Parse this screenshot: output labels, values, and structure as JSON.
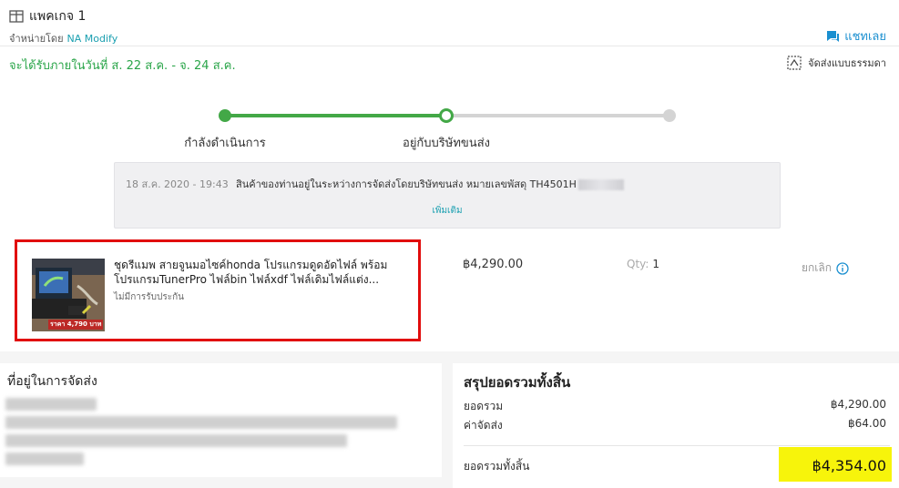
{
  "package": {
    "title": "แพคเกจ 1",
    "seller_label": "จำหน่ายโดย",
    "seller_name": "NA Modify",
    "chat_label": "แชทเลย"
  },
  "delivery": {
    "eta": "จะได้รับภายในวันที่ ส. 22 ส.ค. - จ. 24 ส.ค.",
    "method": "จัดส่งแบบธรรมดา"
  },
  "tracker": {
    "steps": [
      "กำลังดำเนินการ",
      "อยู่กับบริษัทขนส่ง"
    ],
    "step_count": 3,
    "current_step": 2,
    "colors": {
      "done": "#43a847",
      "pending": "#d4d4d4"
    }
  },
  "log": {
    "date": "18 ส.ค. 2020 - 19:43",
    "text": "สินค้าของท่านอยู่ในระหว่างการจัดส่งโดยบริษัทขนส่ง หมายเลขพัสดุ TH4501H",
    "more": "เพิ่มเติม"
  },
  "item": {
    "name": "ชุดรีแมพ สายจูนมอไซค์honda โปรแกรมดูดอัดไฟล์ พร้อมโปรแกรมTunerPro ไฟล์bin ไฟล์xdf ไฟล์เดิมไฟล์แต่ง...",
    "warranty": "ไม่มีการรับประกัน",
    "thumb_caption": "ราคา 4,790 บาท",
    "price": "฿4,290.00",
    "qty_label": "Qty:",
    "qty_value": "1",
    "cancel_label": "ยกเลิก",
    "highlight_color": "#e10d0d"
  },
  "address": {
    "title": "ที่อยู่ในการจัดส่ง"
  },
  "summary": {
    "title": "สรุปยอดรวมทั้งสิ้น",
    "subtotal_label": "ยอดรวม",
    "subtotal_value": "฿4,290.00",
    "shipping_label": "ค่าจัดส่ง",
    "shipping_value": "฿64.00",
    "total_label": "ยอดรวมทั้งสิ้น",
    "total_value": "฿4,354.00",
    "highlight_color": "#f7f40b"
  }
}
